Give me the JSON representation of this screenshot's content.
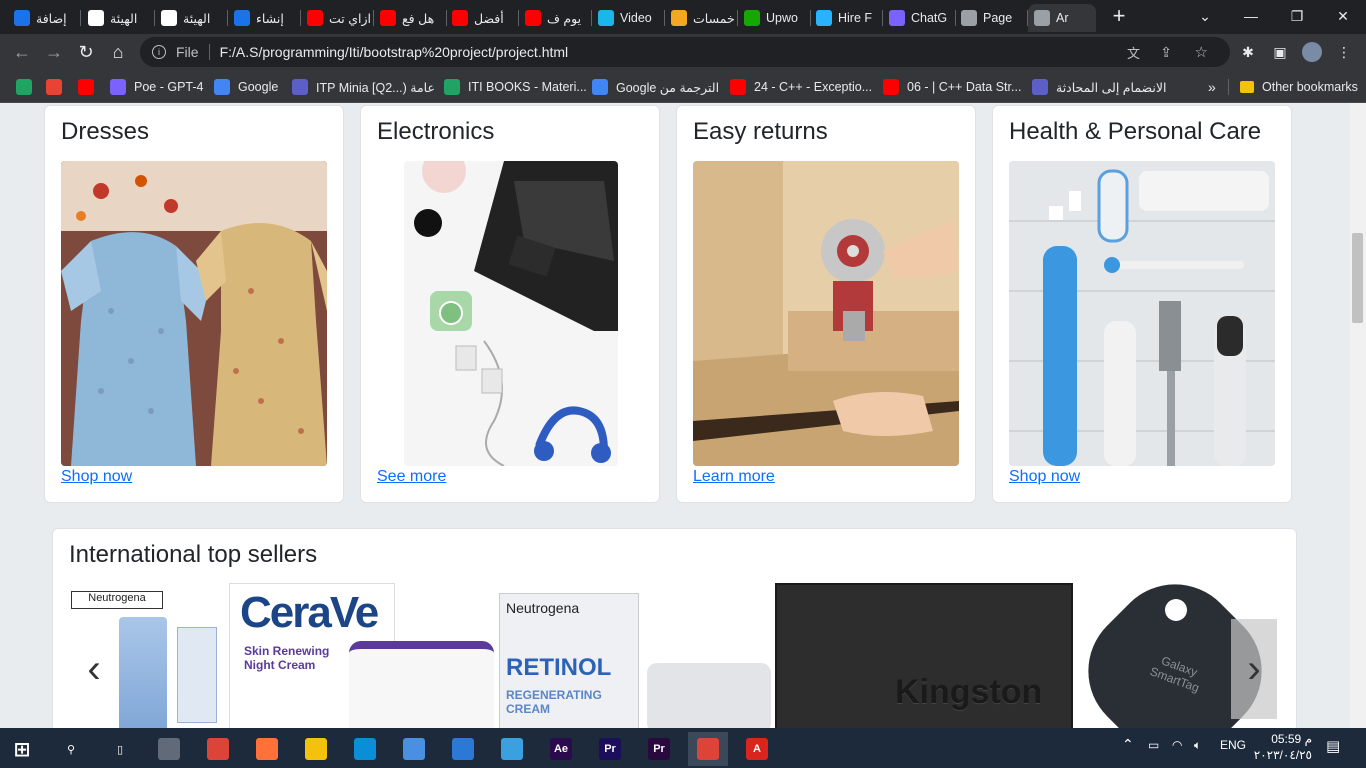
{
  "browser": {
    "tabs": [
      {
        "label": "إضافة",
        "favicon": "circle-blue",
        "color": "#1a73e8"
      },
      {
        "label": "الهيئة",
        "favicon": "egov",
        "color": "#ffffff"
      },
      {
        "label": "الهيئة",
        "favicon": "egov",
        "color": "#ffffff"
      },
      {
        "label": "إنشاء",
        "favicon": "circle-blue",
        "color": "#1a73e8"
      },
      {
        "label": "ازاي تت",
        "favicon": "youtube",
        "color": "#ff0000"
      },
      {
        "label": "هل فع",
        "favicon": "youtube",
        "color": "#ff0000"
      },
      {
        "label": "أفضل",
        "favicon": "youtube",
        "color": "#ff0000"
      },
      {
        "label": "يوم ف",
        "favicon": "youtube",
        "color": "#ff0000"
      },
      {
        "label": "Video",
        "favicon": "vimeo",
        "color": "#1ab7ea"
      },
      {
        "label": "خمسات",
        "favicon": "khamsat",
        "color": "#f5a623"
      },
      {
        "label": "Upwo",
        "favicon": "upwork",
        "color": "#14a800"
      },
      {
        "label": "Hire F",
        "favicon": "freelancer",
        "color": "#29b2fe"
      },
      {
        "label": "ChatG",
        "favicon": "poe",
        "color": "#7b61ff"
      },
      {
        "label": "Page",
        "favicon": "globe",
        "color": "#9aa0a6"
      },
      {
        "label": "Ar",
        "favicon": "globe",
        "color": "#9aa0a6",
        "active": true
      }
    ],
    "url_scheme": "File",
    "url": "F:/A.S/programming/Iti/bootstrap%20project/project.html",
    "bookmarks": [
      {
        "label": "",
        "favicon": "google-drive"
      },
      {
        "label": "",
        "favicon": "gmail"
      },
      {
        "label": "",
        "favicon": "youtube"
      },
      {
        "label": "Poe - GPT-4",
        "favicon": "poe"
      },
      {
        "label": "Google",
        "favicon": "google"
      },
      {
        "label": "ITP Minia [Q2...) عامة",
        "favicon": "teams"
      },
      {
        "label": "ITI BOOKS - Materi...",
        "favicon": "google-drive"
      },
      {
        "label": "Google الترجمة من",
        "favicon": "translate"
      },
      {
        "label": "24 - C++ - Exceptio...",
        "favicon": "youtube"
      },
      {
        "label": "06 - | C++ Data Str...",
        "favicon": "youtube"
      },
      {
        "label": "الانضمام إلى المحادثة",
        "favicon": "teams"
      }
    ],
    "bookmarks_more": "»",
    "other_bookmarks": "Other bookmarks"
  },
  "cards": [
    {
      "title": "Dresses",
      "link": "Shop now",
      "image": "dresses-image"
    },
    {
      "title": "Electronics",
      "link": "See more",
      "image": "electronics-image"
    },
    {
      "title": "Easy returns",
      "link": "Learn more",
      "image": "returns-image"
    },
    {
      "title": "Health & Personal Care",
      "link": "Shop now",
      "image": "health-image"
    }
  ],
  "sellers": {
    "title": "International top sellers",
    "items": [
      {
        "name": "neutrogena-retinol-eye-cream",
        "text": "Neutrogena"
      },
      {
        "name": "cerave-night-cream",
        "text": "CeraVe",
        "line2": "Skin Renewing Night Cream"
      },
      {
        "name": "neutrogena-retinol-cream",
        "text": "Neutrogena",
        "line2": "RETINOL",
        "line3": "REGENERATING CREAM"
      },
      {
        "name": "kingston-ssd",
        "text": "Kingston"
      },
      {
        "name": "galaxy-smarttag",
        "text": "Galaxy SmartTag"
      }
    ],
    "prev_icon": "‹",
    "next_icon": "›"
  },
  "taskbar": {
    "apps": [
      "start",
      "search",
      "task-view",
      "calculator",
      "chrome",
      "firefox",
      "file-explorer",
      "edge",
      "store",
      "mail",
      "vpn",
      "after-effects",
      "premiere",
      "premiere-pro",
      "chrome-active",
      "acrobat"
    ],
    "lang": "ENG",
    "time": "05:59 م",
    "date": "٢٠٢٣/٠٤/٢٥"
  },
  "colors": {
    "link": "#0d6efd",
    "page_bg": "#e9ecef",
    "browser_dark": "#35363a"
  }
}
